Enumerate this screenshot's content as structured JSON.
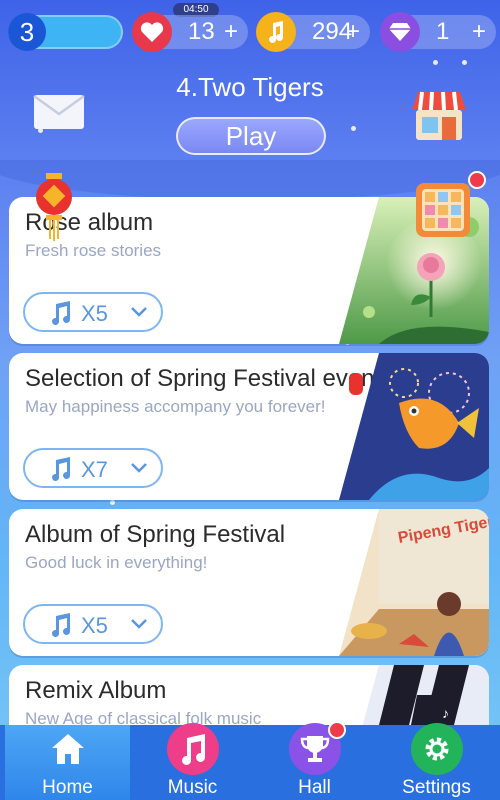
{
  "status": {
    "level": "3",
    "timer": "04:50",
    "resources": [
      {
        "icon": "heart-icon",
        "value": "13",
        "plus": "+",
        "color": "#e8384b"
      },
      {
        "icon": "music-note-icon",
        "value": "294",
        "plus": "+",
        "color": "#f5b21b"
      },
      {
        "icon": "diamond-icon",
        "value": "1",
        "plus": "+",
        "color": "#8a4fe0"
      }
    ]
  },
  "header": {
    "song_title": "4.Two Tigers",
    "play_label": "Play"
  },
  "albums": [
    {
      "title": "Rose album",
      "subtitle": "Fresh rose stories",
      "count": "X5"
    },
    {
      "title": "Selection of Spring Festival event",
      "subtitle": "May happiness accompany you forever!",
      "count": "X7"
    },
    {
      "title": "Album of Spring Festival",
      "subtitle": "Good luck in everything!",
      "count": "X5"
    },
    {
      "title": "Remix Album",
      "subtitle": "New Age of classical folk music",
      "count": ""
    }
  ],
  "nav": [
    {
      "label": "Home",
      "icon": "home-icon",
      "color": "#2f86ea"
    },
    {
      "label": "Music",
      "icon": "music-icon",
      "color": "#ee3e8a"
    },
    {
      "label": "Hall",
      "icon": "trophy-icon",
      "color": "#8a52e6"
    },
    {
      "label": "Settings",
      "icon": "gear-icon",
      "color": "#23b35a"
    }
  ],
  "art": {
    "poster_text": "Pipeng Tigers"
  }
}
